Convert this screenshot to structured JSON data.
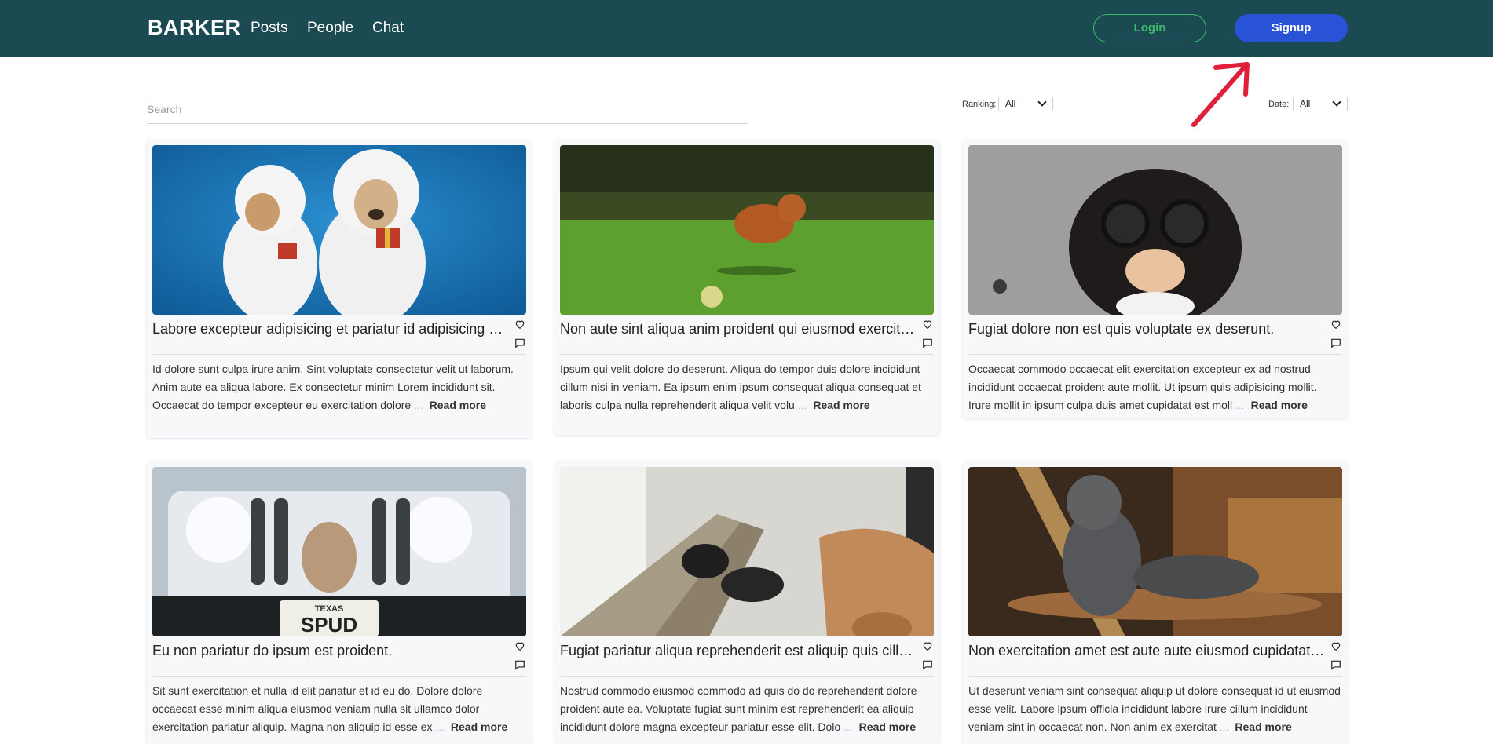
{
  "nav": {
    "brand": "BARKER",
    "links": [
      "Posts",
      "People",
      "Chat"
    ],
    "login_label": "Login",
    "signup_label": "Signup"
  },
  "filters": {
    "search_placeholder": "Search",
    "ranking_label": "Ranking:",
    "ranking_value": "All",
    "date_label": "Date:",
    "date_value": "All"
  },
  "read_more_label": "Read more",
  "ellipsis": "...",
  "posts": [
    {
      "title": "Labore excepteur adipisicing et pariatur id adipisicing nulla.",
      "excerpt": "Id dolore sunt culpa irure anim. Sint voluptate consectetur velit ut laborum. Anim aute ea aliqua labore. Ex consectetur minim Lorem incididunt sit. Occaecat do tempor excepteur eu exercitation dolore",
      "image": "two-dogs-in-fluffy-costumes"
    },
    {
      "title": "Non aute sint aliqua anim proident qui eiusmod exercitation.",
      "excerpt": "Ipsum qui velit dolore do deserunt. Aliqua do tempor duis dolore incididunt cillum nisi in veniam. Ea ipsum enim ipsum consequat aliqua consequat et laboris culpa nulla reprehenderit aliqua velit volu",
      "image": "dog-running-on-grass"
    },
    {
      "title": "Fugiat dolore non est quis voluptate ex deserunt.",
      "excerpt": "Occaecat commodo occaecat elit exercitation excepteur ex ad nostrud incididunt occaecat proident aute mollit. Ut ipsum quis adipisicing mollit. Irure mollit in ipsum culpa duis amet cupidatat est moll",
      "image": "dog-with-disguise-glasses"
    },
    {
      "title": "Eu non pariatur do ipsum est proident.",
      "excerpt": "Sit sunt exercitation et nulla id elit pariatur et id eu do. Dolore dolore occaecat esse minim aliqua eiusmod veniam nulla sit ullamco dolor exercitation pariatur aliquip. Magna non aliquip id esse ex",
      "image": "dog-on-jeep-bumper",
      "plate_top": "TEXAS",
      "plate_main": "SPUD"
    },
    {
      "title": "Fugiat pariatur aliqua reprehenderit est aliquip quis cillum.",
      "excerpt": "Nostrud commodo eiusmod commodo ad quis do do reprehenderit dolore proident aute ea. Voluptate fugiat sunt minim est reprehenderit ea aliquip incididunt dolore magna excepteur pariatur esse elit. Dolo",
      "image": "feet-in-hammock-with-dog"
    },
    {
      "title": "Non exercitation amet est aute aute eiusmod cupidatat sint.",
      "excerpt": "Ut deserunt veniam sint consequat aliquip ut dolore consequat id ut eiusmod esse velit. Labore ipsum officia incididunt labore irure cillum incididunt veniam sint in occaecat non. Non anim ex exercitat",
      "image": "cat-on-wooden-chair"
    }
  ]
}
